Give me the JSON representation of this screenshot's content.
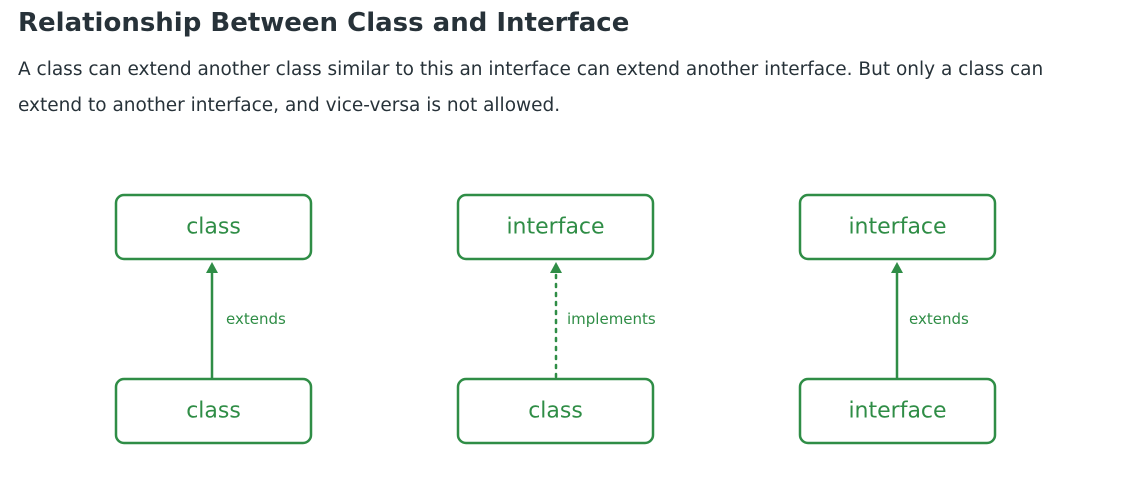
{
  "heading": "Relationship Between Class and Interface",
  "description": "A class can extend another class similar to this an interface can extend another interface. But only a class can extend to another interface, and vice-versa is not allowed.",
  "colors": {
    "accent": "#2f8d46",
    "text": "#273239",
    "background": "#ffffff"
  },
  "diagrams": [
    {
      "top_box": "class",
      "bottom_box": "class",
      "relation": "extends",
      "line_style": "solid"
    },
    {
      "top_box": "interface",
      "bottom_box": "class",
      "relation": "implements",
      "line_style": "dashed"
    },
    {
      "top_box": "interface",
      "bottom_box": "interface",
      "relation": "extends",
      "line_style": "solid"
    }
  ]
}
